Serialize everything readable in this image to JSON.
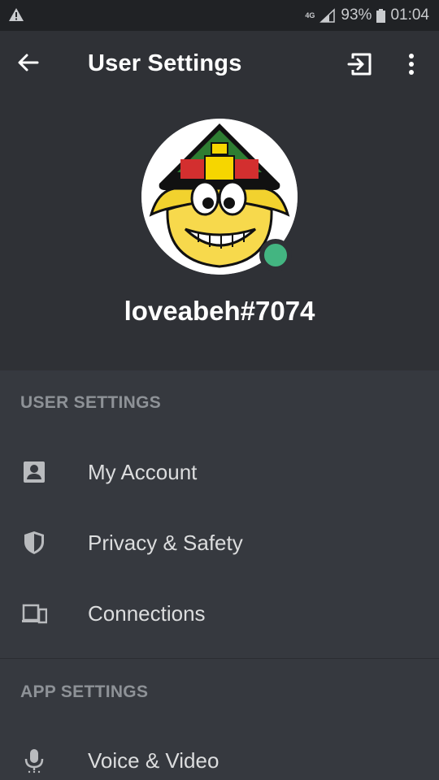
{
  "status_bar": {
    "network": "4G",
    "battery": "93%",
    "time": "01:04",
    "icons": [
      "warning-icon",
      "signal-icon",
      "battery-icon"
    ]
  },
  "toolbar": {
    "title": "User Settings",
    "icons": [
      "back-arrow-icon",
      "logout-icon",
      "more-vertical-icon"
    ]
  },
  "profile": {
    "username": "loveabeh#7074",
    "status_color": "#43b581"
  },
  "sections": {
    "user_settings": {
      "heading": "USER SETTINGS",
      "items": [
        {
          "label": "My Account",
          "icon": "account-card-icon"
        },
        {
          "label": "Privacy & Safety",
          "icon": "shield-icon"
        },
        {
          "label": "Connections",
          "icon": "devices-icon"
        }
      ]
    },
    "app_settings": {
      "heading": "APP SETTINGS",
      "items": [
        {
          "label": "Voice & Video",
          "icon": "microphone-icon"
        }
      ]
    }
  },
  "colors": {
    "background": "#36393f",
    "header_background": "#2f3136",
    "status_bar_background": "#202225",
    "online_green": "#43b581"
  }
}
